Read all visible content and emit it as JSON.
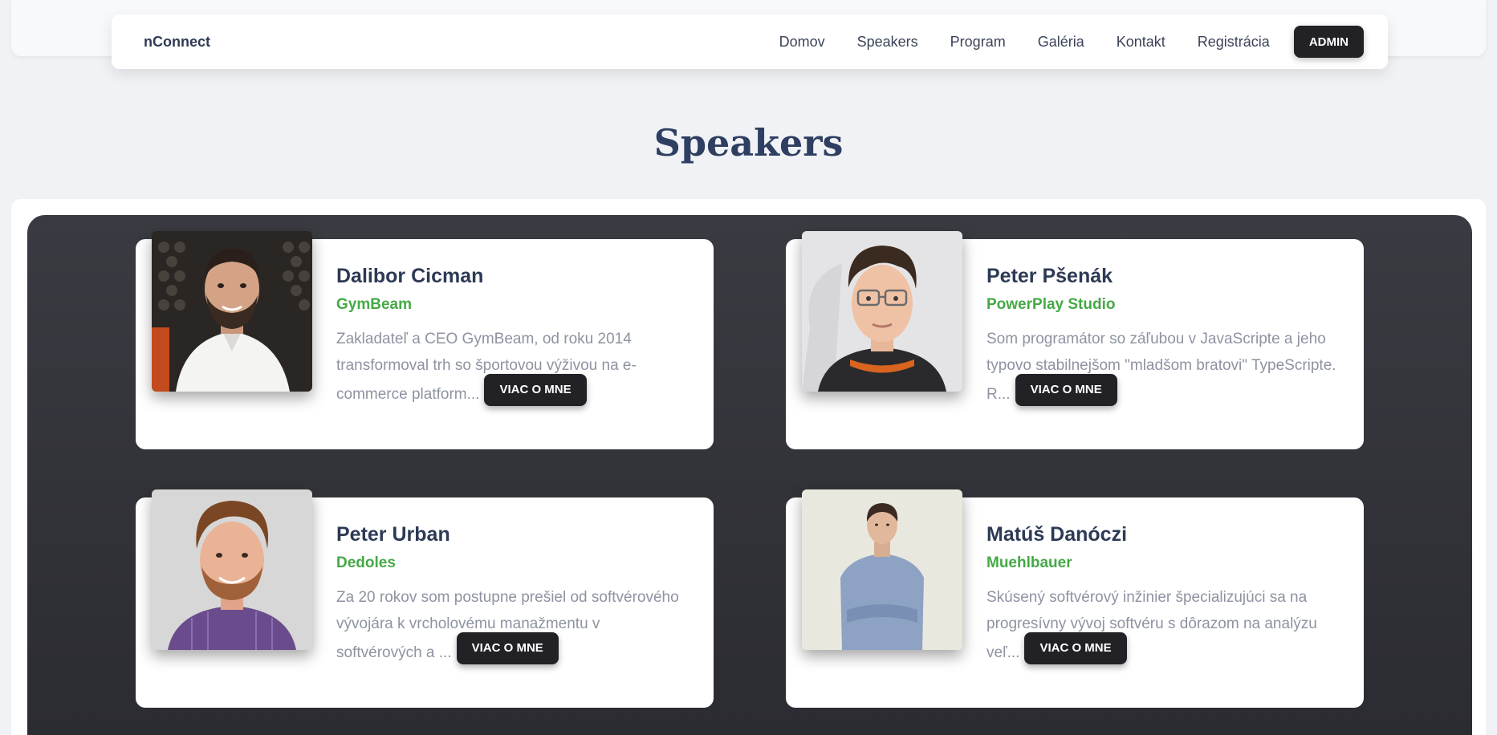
{
  "header": {
    "brand": "nConnect",
    "nav": [
      {
        "label": "Domov"
      },
      {
        "label": "Speakers"
      },
      {
        "label": "Program"
      },
      {
        "label": "Galéria"
      },
      {
        "label": "Kontakt"
      },
      {
        "label": "Registrácia"
      }
    ],
    "admin_label": "ADMIN"
  },
  "main": {
    "title": "Speakers",
    "speakers": [
      {
        "name": "Dalibor Cicman",
        "company": "GymBeam",
        "description": "Zakladateľ a CEO GymBeam, od roku 2014 transformoval trh so športovou výživou na e-commerce platform...",
        "button_label": "VIAC O MNE"
      },
      {
        "name": "Peter Pšenák",
        "company": "PowerPlay Studio",
        "description": "Som programátor so záľubou v JavaScripte a jeho typovo stabilnejšom \"mladšom bratovi\" TypeScripte. R...",
        "button_label": "VIAC O MNE"
      },
      {
        "name": "Peter Urban",
        "company": "Dedoles",
        "description": "Za 20 rokov som postupne prešiel od softvérového vývojára k vrcholovému manažmentu v softvérových a ...",
        "button_label": "VIAC O MNE"
      },
      {
        "name": "Matúš Danóczi",
        "company": "Muehlbauer",
        "description": "Skúsený softvérový inžinier špecializujúci sa na progresívny vývoj softvéru s dôrazom na analýzu veľ...",
        "button_label": "VIAC O MNE"
      }
    ]
  },
  "colors": {
    "accent_green": "#45a946",
    "dark_button": "#222226",
    "title_navy": "#2f3f61",
    "panel_dark": "#2f3036"
  }
}
